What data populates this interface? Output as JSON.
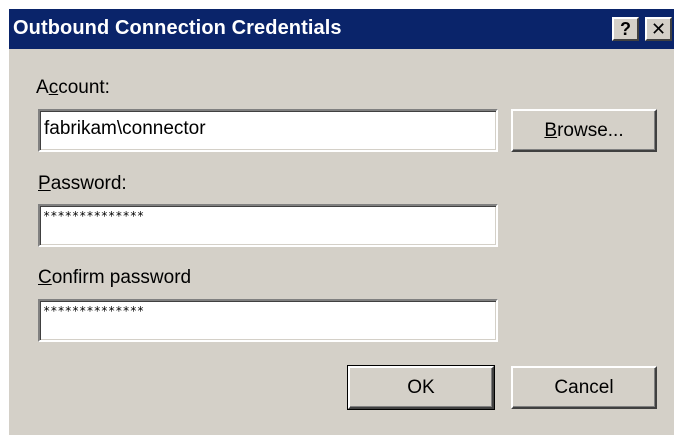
{
  "window": {
    "title": "Outbound Connection Credentials",
    "help_label": "?",
    "close_label": "✕"
  },
  "account": {
    "label_mnemonic": "A",
    "label_rest_1": "c",
    "label_underlined": "c",
    "label_rest": "count:",
    "value": "fabrikam\\connector"
  },
  "browse_button": {
    "underlined": "B",
    "rest": "rowse..."
  },
  "password": {
    "underlined": "P",
    "rest": "assword:",
    "value": "**************"
  },
  "confirm_password": {
    "underlined": "C",
    "rest": "onfirm password",
    "value": "**************"
  },
  "ok_button": {
    "label": "OK"
  },
  "cancel_button": {
    "label": "Cancel"
  }
}
